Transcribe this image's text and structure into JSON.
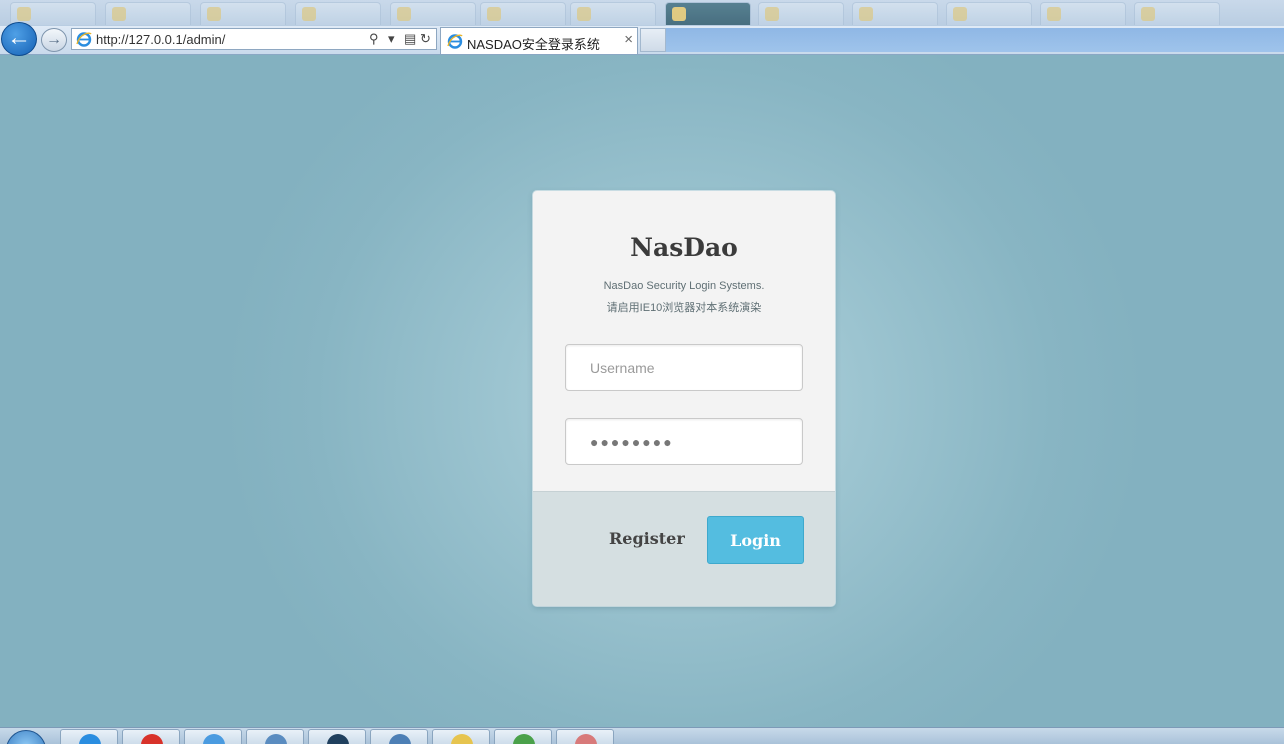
{
  "browser": {
    "address_url": "http://127.0.0.1/admin/",
    "active_tab_title": "NASDAO安全登录系统",
    "tab_close_glyph": "×",
    "back_glyph": "←",
    "forward_glyph": "→",
    "search_glyph": "⚲",
    "dropdown_glyph": "▾",
    "compat_glyph": "▤",
    "refresh_glyph": "↻"
  },
  "login": {
    "brand": "NasDao",
    "subtitle": "NasDao Security Login Systems.",
    "note": "请启用IE10浏览器对本系统演染",
    "username_placeholder": "Username",
    "password_value": "●●●●●●●●",
    "register_label": "Register",
    "login_label": "Login"
  },
  "colors": {
    "page_bg": "#8fb8c6",
    "card_bg": "#f3f3f3",
    "footer_bg": "#d5dfe1",
    "login_button": "#54bde0"
  },
  "icons": {
    "ie_icon": "ie-icon",
    "back": "back-arrow-icon",
    "forward": "forward-arrow-icon",
    "search": "search-icon",
    "refresh": "refresh-icon",
    "compat": "compatibility-view-icon",
    "close": "close-icon"
  }
}
